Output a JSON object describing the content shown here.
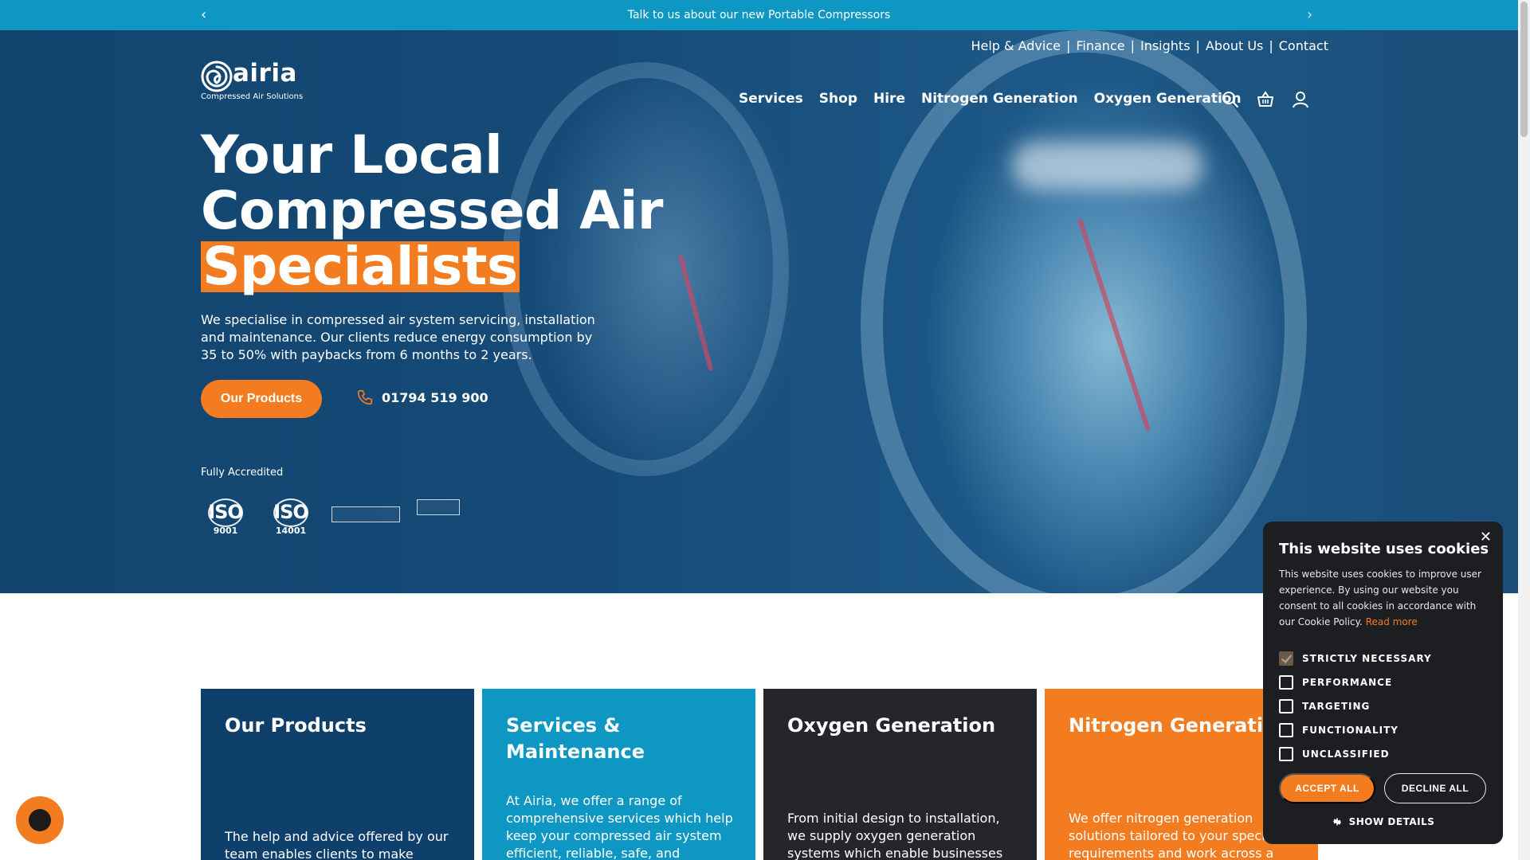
{
  "announcement": {
    "text": "Talk to us about our new Portable Compressors",
    "prev_icon": "chevron-left-icon",
    "next_icon": "chevron-right-icon"
  },
  "utility_nav": [
    "Help & Advice",
    "Finance",
    "Insights",
    "About Us",
    "Contact"
  ],
  "logo": {
    "word": "airia",
    "tagline": "Compressed Air Solutions"
  },
  "main_nav": [
    "Services",
    "Shop",
    "Hire",
    "Nitrogen Generation",
    "Oxygen Generation"
  ],
  "nav_icons": [
    "search-icon",
    "basket-icon",
    "user-icon"
  ],
  "hero": {
    "title_line1": "Your Local",
    "title_line2": "Compressed Air",
    "title_line3": "Specialists",
    "description": "We specialise in compressed air system servicing, installation and maintenance. Our clients reduce energy consumption by 35 to 50% with paybacks from 6 months to 2 years.",
    "cta_label": "Our Products",
    "phone": "01794 519 900"
  },
  "accreditation": {
    "label": "Fully Accredited",
    "badges": [
      {
        "word": "ISO",
        "number": "9001"
      },
      {
        "word": "ISO",
        "number": "14001"
      }
    ]
  },
  "cards": [
    {
      "title": "Our Products",
      "text": "The help and advice offered by our team enables clients to make energy"
    },
    {
      "title": "Services & Maintenance",
      "text": "At Airia, we offer a range of comprehensive services which help keep your compressed air system efficient, reliable, safe, and"
    },
    {
      "title": "Oxygen Generation",
      "text": "From initial design to installation, we supply oxygen generation systems which enable businesses to produce"
    },
    {
      "title": "Nitrogen Generation",
      "text": "We offer nitrogen generation solutions tailored to your specific requirements and work across a"
    }
  ],
  "cookie": {
    "title": "This website uses cookies",
    "body": "This website uses cookies to improve user experience. By using our website you consent to all cookies in accordance with our Cookie Policy.",
    "read_more": "Read more",
    "options": [
      {
        "label": "STRICTLY NECESSARY",
        "checked": true
      },
      {
        "label": "PERFORMANCE",
        "checked": false
      },
      {
        "label": "TARGETING",
        "checked": false
      },
      {
        "label": "FUNCTIONALITY",
        "checked": false
      },
      {
        "label": "UNCLASSIFIED",
        "checked": false
      }
    ],
    "accept_label": "ACCEPT ALL",
    "decline_label": "DECLINE ALL",
    "details_label": "SHOW DETAILS",
    "close_glyph": "✕"
  },
  "colors": {
    "brand_orange": "#f47c20",
    "brand_blue": "#0e97c3",
    "navy": "#0f3f6b",
    "dark": "#25262b"
  }
}
